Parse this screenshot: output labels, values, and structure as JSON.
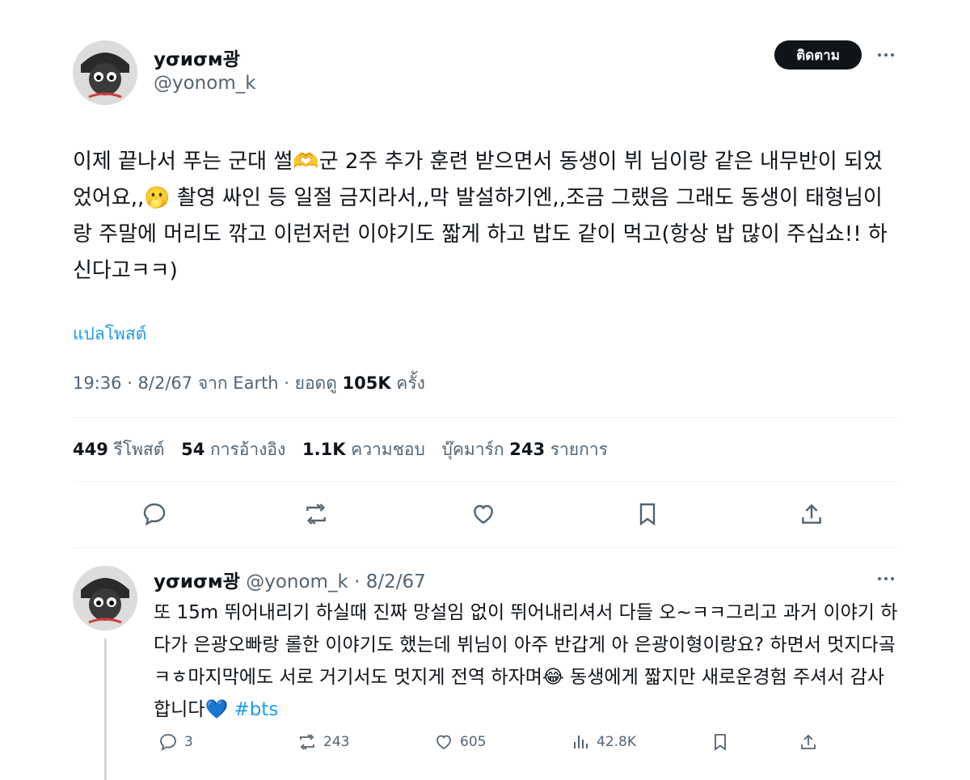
{
  "main_tweet": {
    "display_name": "yσиσм광",
    "handle": "@yonom_k",
    "follow_label": "ติดตาม",
    "text": "이제 끝나서 푸는 군대 썰🫶군 2주 추가 훈련 받으면서 동생이 뷔 님이랑 같은 내무반이 되었었어요,,🫢 촬영 싸인 등 일절 금지라서,,막 발설하기엔,,조금 그랬음 그래도 동생이 태형님이랑 주말에 머리도 깎고 이런저런 이야기도 짧게 하고 밥도 같이 먹고(항상 밥 많이 주십쇼!! 하신다고ㅋㅋ)",
    "translate_label": "แปลโพสต์",
    "meta_prefix": "19:36 · 8/2/67 จาก Earth · ยอดดู ",
    "views": "105K",
    "views_suffix": " ครั้ง",
    "stats": {
      "reposts": "449",
      "reposts_label": " รีโพสต์",
      "quotes": "54",
      "quotes_label": " การอ้างอิง",
      "likes": "1.1K",
      "likes_label": " ความชอบ",
      "bookmarks_label": "บุ๊คมาร์ก ",
      "bookmarks": "243",
      "bookmarks_suffix": " รายการ"
    }
  },
  "reply_tweet": {
    "display_name": "yσиσм광",
    "handle_date": " @yonom_k · 8/2/67",
    "text": "또 15m 뛰어내리기 하실때 진짜 망설임 없이 뛰어내리셔서 다들 오~ㅋㅋ그리고 과거 이야기 하다가 은광오빠랑 롤한 이야기도 했는데 뷔님이 아주 반갑게 아 은광이형이랑요? 하면서 멋지다곸ㅋㅎ마지막에도 서로 거기서도 멋지게 전역 하자며😂 동생에게 짧지만 새로운경험 주셔서 감사합니다💙 ",
    "hashtag": "#bts",
    "actions": {
      "replies": "3",
      "reposts": "243",
      "likes": "605",
      "views": "42.8K"
    }
  },
  "colors": {
    "text": "#0f1419",
    "secondary": "#536471",
    "link": "#1d9bf0",
    "divider": "#eff3f4"
  }
}
